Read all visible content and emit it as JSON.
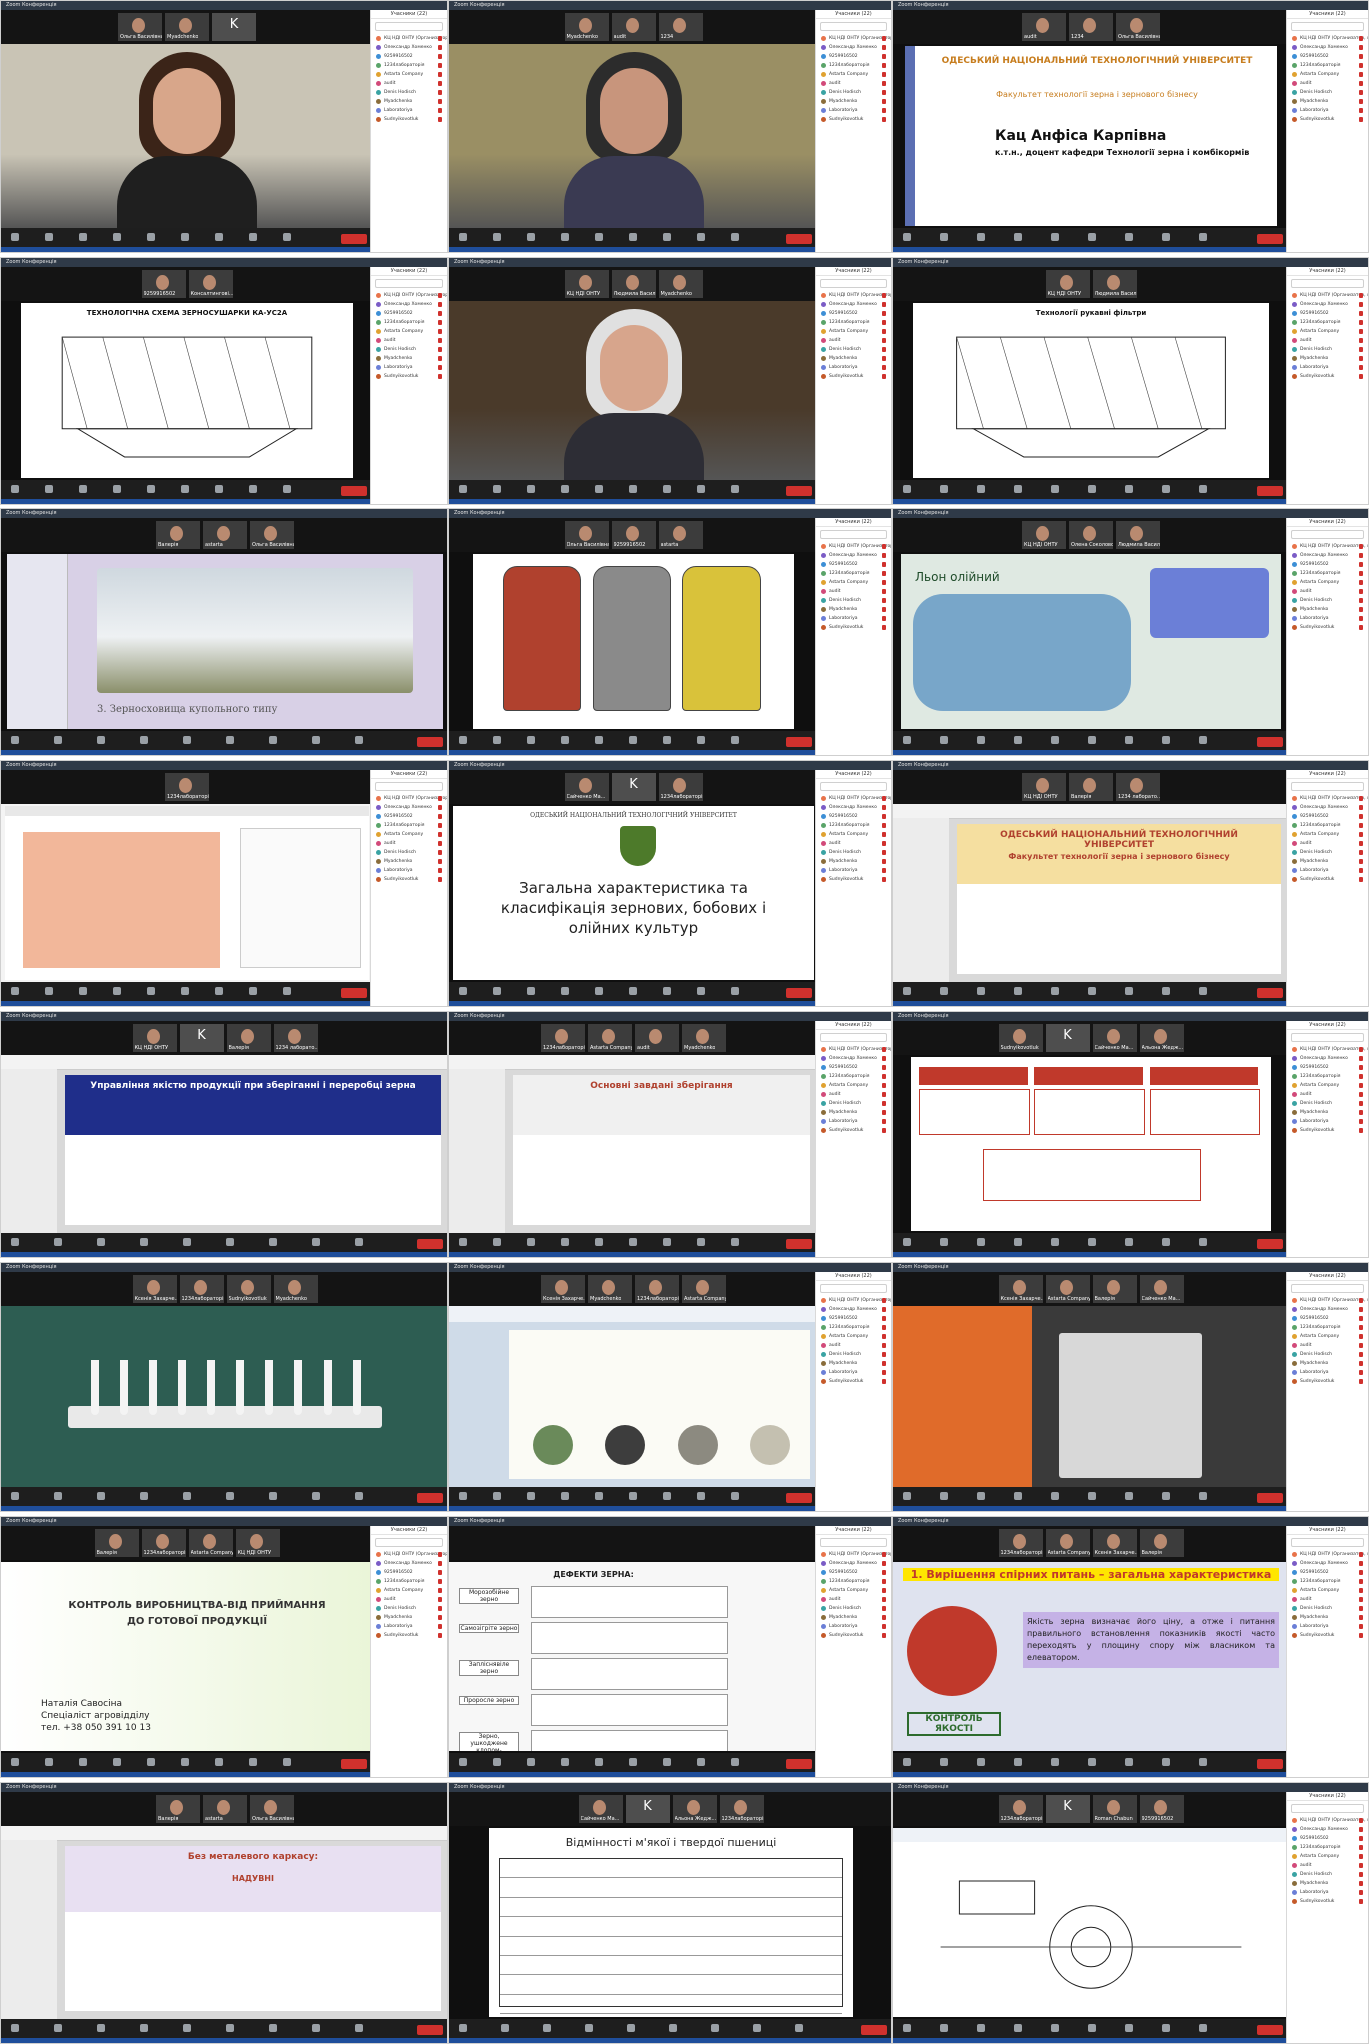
{
  "collage": {
    "columns": 3,
    "rows": 8
  },
  "app": {
    "title": "Zoom Конференція",
    "participants_title": "Учасники (22)",
    "search_placeholder": "Найти участника",
    "invite_label": "Пригласить",
    "mute_all_label": "Выключить звук для всех",
    "end_label": "Завершить"
  },
  "participants": [
    {
      "name": "КЦ НДІ ОНТУ (Организатор, я)",
      "color": "#e8734a"
    },
    {
      "name": "Олександр Хоменко",
      "color": "#7b5cc6"
    },
    {
      "name": "9259916502",
      "color": "#3d8fd6"
    },
    {
      "name": "1234лабораторія",
      "color": "#5aa469"
    },
    {
      "name": "Astarta Company",
      "color": "#e0a230"
    },
    {
      "name": "audit",
      "color": "#d24a7a"
    },
    {
      "name": "Denis Hodisch",
      "color": "#3aa3a3"
    },
    {
      "name": "Myadchenko",
      "color": "#8a6d3b"
    },
    {
      "name": "Laboratoriya",
      "color": "#6b7fd7"
    },
    {
      "name": "Sudnyikovotluk",
      "color": "#c55a2a"
    }
  ],
  "tiles": [
    {
      "id": "r1c1",
      "kind": "camera",
      "strip": [
        "Ольга Василівна",
        "Myadchenko",
        "K"
      ],
      "bg": "#c9c4b5",
      "skin": "#d8a68a",
      "hair": "#3b2418",
      "shirt": "#1f1f1f",
      "panel": true
    },
    {
      "id": "r1c2",
      "kind": "camera",
      "strip": [
        "Myadchenko",
        "audit",
        "1234"
      ],
      "bg": "#9a8f64",
      "skin": "#c8957c",
      "hair": "#2c2c2c",
      "shirt": "#3a3a52",
      "panel": true
    },
    {
      "id": "r1c3",
      "kind": "title",
      "strip": [
        "audit",
        "1234",
        "Ольга Василівна"
      ],
      "panel": true,
      "lines": [
        "ОДЕСЬКИЙ НАЦІОНАЛЬНИЙ ТЕХНОЛОГІЧНИЙ УНІВЕРСИТЕТ",
        "Факультет технології зерна і зернового бізнесу",
        "Кац Анфіса Карпівна",
        "к.т.н., доцент кафедри Технології зерна і комбікормів"
      ],
      "accent": "#c77d1e"
    },
    {
      "id": "r2c1",
      "kind": "diagram",
      "strip": [
        "9259916502",
        "Консалтингові..."
      ],
      "panel": true,
      "lines": [
        "ТЕХНОЛОГІЧНА СХЕМА ЗЕРНОСУШАРКИ КА-УС2А"
      ]
    },
    {
      "id": "r2c2",
      "kind": "camera",
      "strip": [
        "КЦ НДІ ОНТУ",
        "Людмила Василівна",
        "Myadchenko"
      ],
      "bg": "#4a3a2a",
      "skin": "#d7a58c",
      "hair": "#e0e0e0",
      "shirt": "#2d2d35",
      "panel": true
    },
    {
      "id": "r2c3",
      "kind": "diagram",
      "strip": [
        "КЦ НДІ ОНТУ",
        "Людмила Василівна"
      ],
      "panel": true,
      "lines": [
        "Технології рукавні фільтри"
      ]
    },
    {
      "id": "r3c1",
      "kind": "photo",
      "strip": [
        "Валерія",
        "astarta",
        "Ольга Василівна"
      ],
      "panel": false,
      "lines": [
        "3. Зерносховища купольного типу"
      ],
      "accent": "#d8d0e6"
    },
    {
      "id": "r3c2",
      "kind": "towers",
      "strip": [
        "Ольга Василівна",
        "9259916502",
        "astarta"
      ],
      "panel": true
    },
    {
      "id": "r3c3",
      "kind": "map",
      "strip": [
        "КЦ НДІ ОНТУ",
        "Олена Соколовська",
        "Людмила Василівна"
      ],
      "panel": true,
      "lines": [
        "Льон олійний"
      ]
    },
    {
      "id": "r4c1",
      "kind": "doc",
      "strip": [
        "1234лабораторія"
      ],
      "panel": true,
      "accent": "#f2b79a"
    },
    {
      "id": "r4c2",
      "kind": "title2",
      "strip": [
        "Сайченко Ма...",
        "K",
        "1234лабораторія"
      ],
      "panel": true,
      "lines": [
        "ОДЕСЬКИЙ НАЦІОНАЛЬНИЙ ТЕХНОЛОГІЧНИЙ УНІВЕРСИТЕТ",
        "Загальна характеристика та класифікація зернових, бобових і олійних культур"
      ]
    },
    {
      "id": "r4c3",
      "kind": "ppt",
      "strip": [
        "КЦ НДІ ОНТУ",
        "Валерія",
        "1234 лаборато..."
      ],
      "panel": true,
      "lines": [
        "ОДЕСЬКИЙ НАЦІОНАЛЬНИЙ ТЕХНОЛОГІЧНИЙ УНІВЕРСИТЕТ",
        "Факультет технології зерна і зернового бізнесу"
      ],
      "accent": "#f5dfa0"
    },
    {
      "id": "r5c1",
      "kind": "ppt",
      "strip": [
        "КЦ НДІ ОНТУ",
        "K",
        "Валерія",
        "1234 лаборато..."
      ],
      "panel": false,
      "lines": [
        "Управління якістю продукції при зберіганні і переробці зерна"
      ],
      "accent": "#1f2e8a"
    },
    {
      "id": "r5c2",
      "kind": "ppt",
      "strip": [
        "1234лабораторія",
        "Astarta Company",
        "audit",
        "Myadchenko"
      ],
      "panel": true,
      "lines": [
        "Основні завдані зберігання"
      ],
      "accent": "#f0f0f0"
    },
    {
      "id": "r5c3",
      "kind": "flow",
      "strip": [
        "Sudnyikovotluk",
        "K",
        "Сайченко Ма...",
        "Альона Жедж..."
      ],
      "panel": true
    },
    {
      "id": "r6c1",
      "kind": "lab",
      "strip": [
        "Ксенія Захарче...",
        "1234лабораторія",
        "Sudnyikovotluk",
        "Myadchenko"
      ],
      "panel": false
    },
    {
      "id": "r6c2",
      "kind": "micro",
      "strip": [
        "Ксенія Захарче...",
        "Myadchenko",
        "1234лабораторія",
        "Astarta Company"
      ],
      "panel": true
    },
    {
      "id": "r6c3",
      "kind": "machine",
      "strip": [
        "Ксенія Захарче...",
        "Astarta Company",
        "Валерія",
        "Сайченко Ма..."
      ],
      "panel": true
    },
    {
      "id": "r7c1",
      "kind": "title3",
      "strip": [
        "Валерія",
        "1234лабораторія",
        "Astarta Company",
        "КЦ НДІ ОНТУ"
      ],
      "panel": true,
      "lines": [
        "КОНТРОЛЬ ВИРОБНИЦТВА-ВІД ПРИЙМАННЯ ДО ГОТОВОЇ ПРОДУКЦІЇ",
        "Наталія Савосіна",
        "Спеціаліст агровідділу",
        "тел. +38 050 391 10 13"
      ]
    },
    {
      "id": "r7c2",
      "kind": "defects",
      "strip": [],
      "panel": true,
      "lines": [
        "ДЕФЕКТИ ЗЕРНА:",
        "Морозобійне зерно",
        "Самозігріте зерно",
        "Запліснявіле зерно",
        "Проросле зерно",
        "Зерно, ушкоджене клопом-черепашкою"
      ]
    },
    {
      "id": "r7c3",
      "kind": "stamp",
      "strip": [
        "1234лабораторія",
        "Astarta Company",
        "Ксенія Захарче...",
        "Валерія"
      ],
      "panel": true,
      "lines": [
        "1. Вирішення спірних питань – загальна характеристика",
        "КОНТРОЛЬ ЯКОСТІ",
        "Якість зерна визначає його ціну, а отже і питання правильного встановлення показників якості часто переходять у площину спору між власником та елеватором."
      ]
    },
    {
      "id": "r8c1",
      "kind": "ppt",
      "strip": [
        "Валерія",
        "astarta",
        "Ольга Василівна"
      ],
      "panel": false,
      "lines": [
        "Без металевого каркасу:",
        "НАДУВНІ"
      ],
      "accent": "#e8e0f2"
    },
    {
      "id": "r8c2",
      "kind": "table",
      "strip": [
        "Сайченко Ма...",
        "K",
        "Альона Жедж...",
        "1234лабораторія"
      ],
      "panel": false,
      "lines": [
        "Відмінності м'якої і твердої пшениці"
      ]
    },
    {
      "id": "r8c3",
      "kind": "drawing",
      "strip": [
        "1234лабораторія",
        "K",
        "Roman Chabun",
        "9259916502"
      ],
      "panel": true
    }
  ]
}
